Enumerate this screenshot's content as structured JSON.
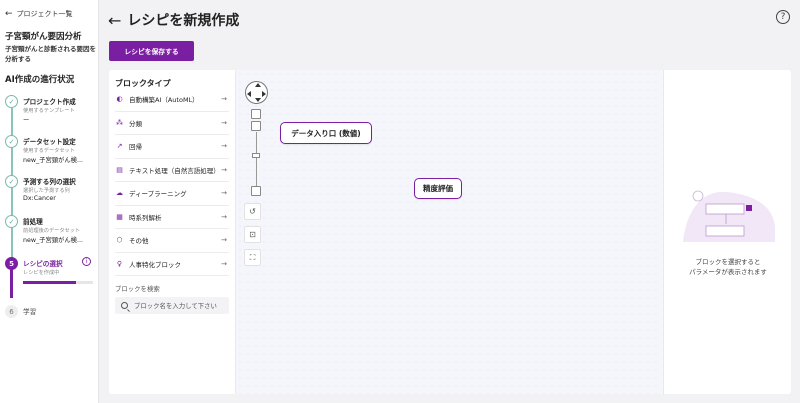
{
  "sidebar": {
    "back_label": "プロジェクト一覧",
    "project_title": "子宮頸がん要因分析",
    "project_desc": "子宮頸がんと診断される要因を分析する",
    "progress_title": "AI作成の進行状況",
    "steps": [
      {
        "name": "プロジェクト作成",
        "sub": "使用するテンプレート",
        "value": "ー"
      },
      {
        "name": "データセット設定",
        "sub": "使用するデータセット",
        "value": "new_子宮頸がん検..."
      },
      {
        "name": "予測する列の選択",
        "sub": "選択した予測する列",
        "value": "Dx:Cancer"
      },
      {
        "name": "前処理",
        "sub": "前処理後のデータセット",
        "value": "new_子宮頸がん検..."
      },
      {
        "number": "5",
        "name": "レシピの選択",
        "sub": "レシピを作成中",
        "progress": 0.75,
        "info": "i"
      },
      {
        "number": "6",
        "name": "学習"
      }
    ]
  },
  "header": {
    "title": "レシピを新規作成",
    "save_label": "レシピを保存する",
    "help": "?"
  },
  "block_panel": {
    "title": "ブロックタイプ",
    "items": [
      {
        "label": "自動構築AI（AutoML）",
        "icon": "automl-icon"
      },
      {
        "label": "分類",
        "icon": "classification-icon"
      },
      {
        "label": "回帰",
        "icon": "regression-icon"
      },
      {
        "label": "テキスト処理（自然言語処理）",
        "icon": "text-icon"
      },
      {
        "label": "ディープラーニング",
        "icon": "deep-learning-icon"
      },
      {
        "label": "時系列解析",
        "icon": "timeseries-icon"
      },
      {
        "label": "その他",
        "icon": "other-icon"
      },
      {
        "label": "人事特化ブロック",
        "icon": "hr-icon"
      }
    ],
    "search_label": "ブロックを検索",
    "search_placeholder": "ブロック名を入力して下さい"
  },
  "canvas": {
    "nodes": [
      {
        "label": "データ入り口 (数値)"
      },
      {
        "label": "精度評価"
      }
    ]
  },
  "param_panel": {
    "message_line1": "ブロックを選択すると",
    "message_line2": "パラメータが表示されます"
  },
  "colors": {
    "accent": "#7a1fa2",
    "step_done": "#7ab8ab"
  }
}
